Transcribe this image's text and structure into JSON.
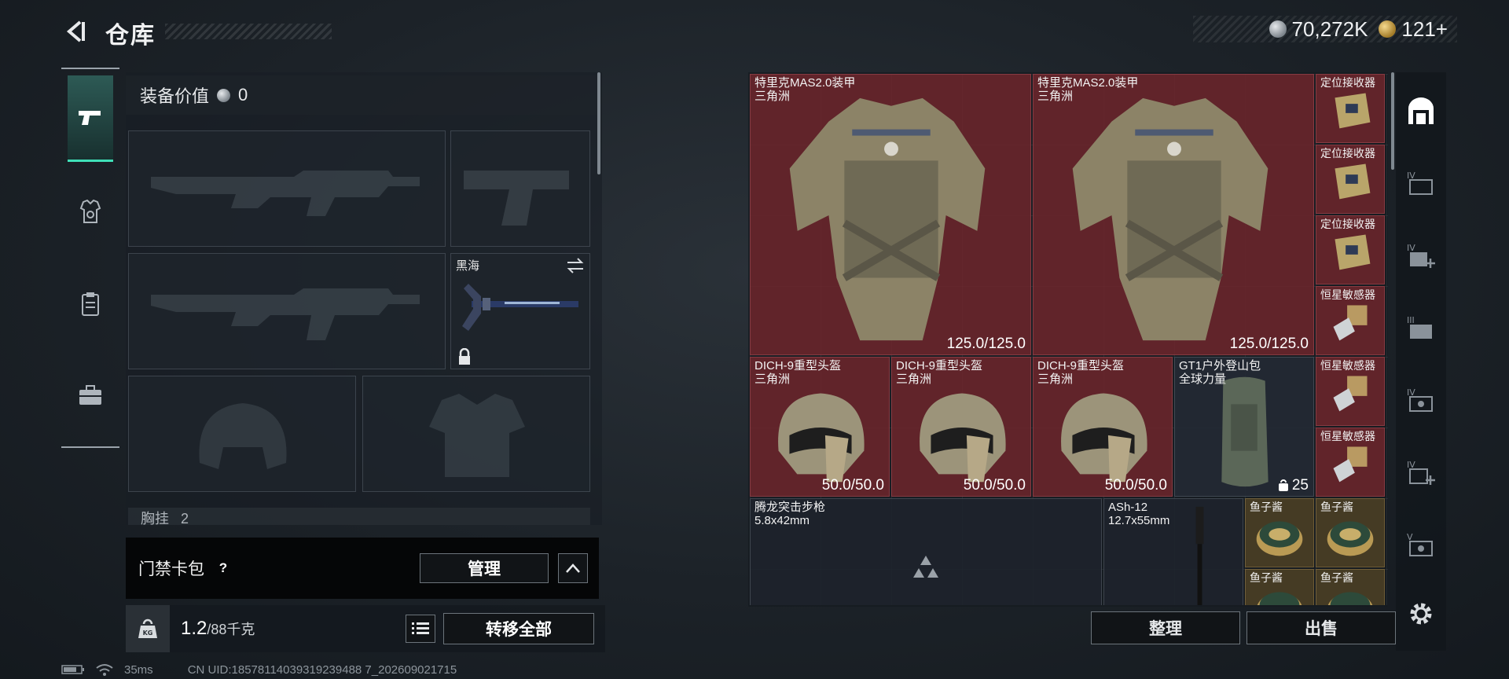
{
  "header": {
    "title": "仓库",
    "currency_silver": "70,272K",
    "currency_gold": "121+"
  },
  "equipment": {
    "value_label": "装备价值",
    "value": "0",
    "melee_name": "黑海",
    "chest_label": "胸挂",
    "chest_count": "2"
  },
  "keycard": {
    "label": "门禁卡包",
    "help": "?",
    "manage_label": "管理"
  },
  "weight": {
    "current": "1.2",
    "capacity": "/88千克",
    "icon_text": "KG",
    "transfer_all_label": "转移全部"
  },
  "status": {
    "ping": "35ms",
    "uid": "CN UID:18578114039319239488 7_202609021715"
  },
  "inventory": {
    "items": [
      {
        "name": "特里克MAS2.0装甲\n三角洲",
        "stat": "125.0/125.0"
      },
      {
        "name": "特里克MAS2.0装甲\n三角洲",
        "stat": "125.0/125.0"
      },
      {
        "name": "定位接收器",
        "stat": ""
      },
      {
        "name": "定位接收器",
        "stat": ""
      },
      {
        "name": "定位接收器",
        "stat": ""
      },
      {
        "name": "恒星敏感器",
        "stat": ""
      },
      {
        "name": "DICH-9重型头盔\n三角洲",
        "stat": "50.0/50.0"
      },
      {
        "name": "DICH-9重型头盔\n三角洲",
        "stat": "50.0/50.0"
      },
      {
        "name": "DICH-9重型头盔\n三角洲",
        "stat": "50.0/50.0"
      },
      {
        "name": "GT1户外登山包\n全球力量",
        "stat": "25"
      },
      {
        "name": "恒星敏感器",
        "stat": ""
      },
      {
        "name": "恒星敏感器",
        "stat": ""
      },
      {
        "name": "腾龙突击步枪\n5.8x42mm",
        "stat": ""
      },
      {
        "name": "ASh-12\n12.7x55mm",
        "stat": ""
      },
      {
        "name": "鱼子酱",
        "stat": ""
      },
      {
        "name": "鱼子酱",
        "stat": ""
      },
      {
        "name": "鱼子酱",
        "stat": ""
      },
      {
        "name": "鱼子酱",
        "stat": ""
      }
    ],
    "sort_label": "整理",
    "sell_label": "出售"
  }
}
